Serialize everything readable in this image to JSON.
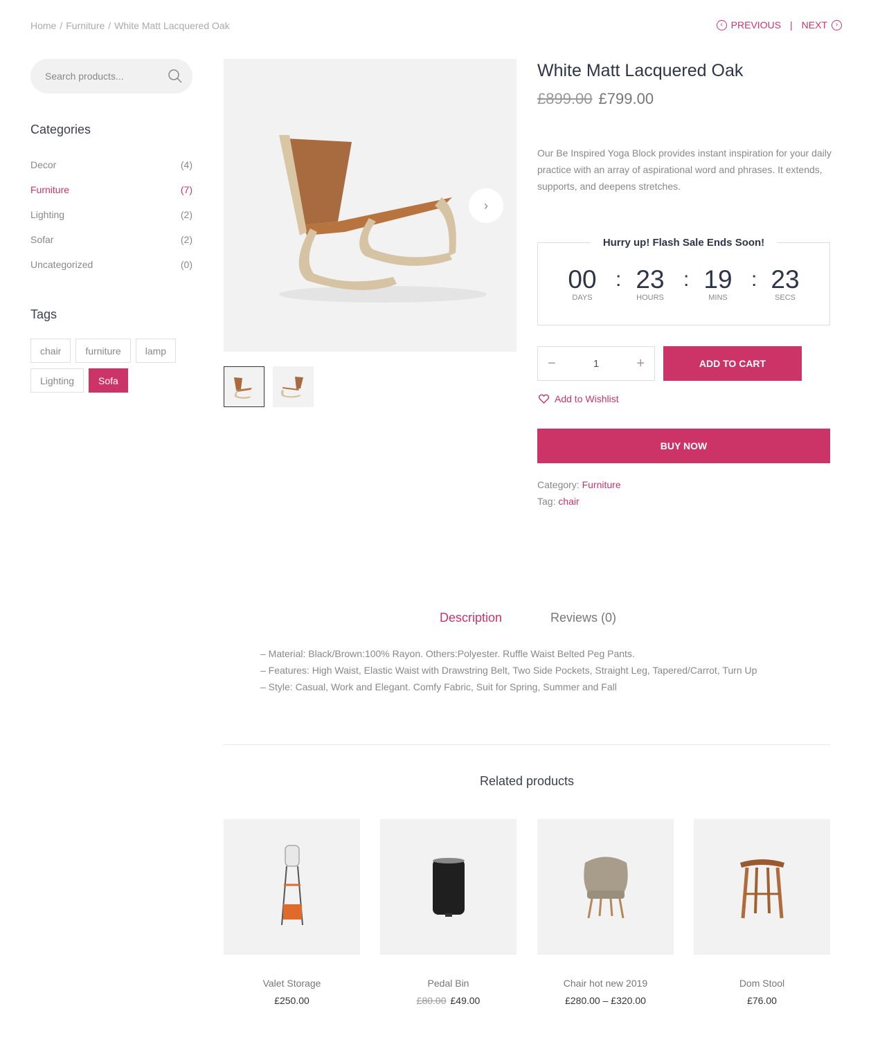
{
  "breadcrumb": {
    "home": "Home",
    "category": "Furniture",
    "current": "White Matt Lacquered Oak",
    "separator": "/"
  },
  "pager": {
    "previous": "PREVIOUS",
    "next": "NEXT",
    "divider": "|"
  },
  "search": {
    "placeholder": "Search products..."
  },
  "categories": {
    "title": "Categories",
    "items": [
      {
        "label": "Decor",
        "count": "(4)"
      },
      {
        "label": "Furniture",
        "count": "(7)"
      },
      {
        "label": "Lighting",
        "count": "(2)"
      },
      {
        "label": "Sofar",
        "count": "(2)"
      },
      {
        "label": "Uncategorized",
        "count": "(0)"
      }
    ]
  },
  "tags": {
    "title": "Tags",
    "items": [
      "chair",
      "furniture",
      "lamp",
      "Lighting",
      "Sofa"
    ]
  },
  "product": {
    "title": "White Matt Lacquered Oak",
    "old_price": "£899.00",
    "price": "£799.00",
    "description": "Our Be Inspired Yoga Block provides instant inspiration for your daily practice with an array of aspirational word and phrases. It extends, supports, and deepens stretches.",
    "quantity": "1",
    "add_to_cart": "ADD TO CART",
    "wishlist": "Add to Wishlist",
    "buy_now": "BUY NOW",
    "category_label": "Category:",
    "category_value": "Furniture",
    "tag_label": "Tag:",
    "tag_value": "chair"
  },
  "flash_sale": {
    "title": "Hurry up! Flash Sale Ends Soon!",
    "separator": ":",
    "days": "00",
    "days_label": "DAYS",
    "hours": "23",
    "hours_label": "HOURS",
    "mins": "19",
    "mins_label": "MINS",
    "secs": "23",
    "secs_label": "SECS"
  },
  "tabs": {
    "description": "Description",
    "reviews": "Reviews (0)",
    "lines": [
      "– Material: Black/Brown:100% Rayon. Others:Polyester. Ruffle Waist Belted Peg Pants.",
      "– Features: High Waist, Elastic Waist with Drawstring Belt, Two Side Pockets, Straight Leg, Tapered/Carrot, Turn Up",
      "– Style: Casual, Work and Elegant. Comfy Fabric, Suit for Spring, Summer and Fall"
    ]
  },
  "related": {
    "title": "Related products",
    "items": [
      {
        "name": "Valet Storage",
        "old_price": "",
        "price": "£250.00"
      },
      {
        "name": "Pedal Bin",
        "old_price": "£80.00",
        "price": "£49.00"
      },
      {
        "name": "Chair hot new 2019",
        "old_price": "",
        "price": "£280.00 – £320.00"
      },
      {
        "name": "Dom Stool",
        "old_price": "",
        "price": "£76.00"
      }
    ]
  },
  "colors": {
    "accent": "#cc3366",
    "heading": "#2e3548",
    "text": "#777777"
  }
}
